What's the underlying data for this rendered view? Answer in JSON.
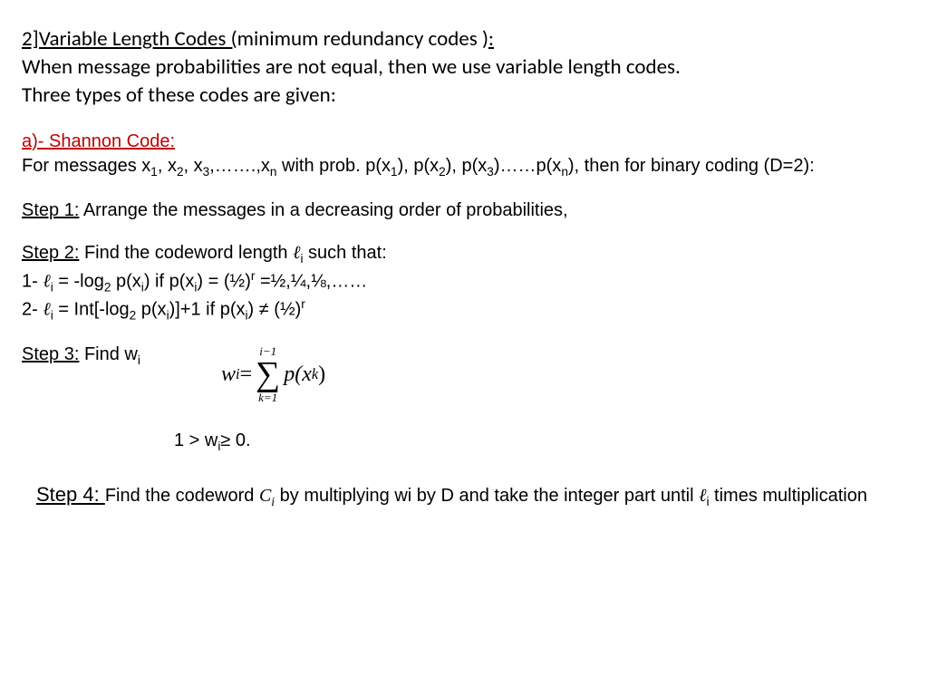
{
  "title": {
    "prefix": "2]Variable Length Codes (",
    "mid": "minimum redundancy codes )",
    "suffix": ":"
  },
  "intro": {
    "line1": "When message probabilities are not equal, then we use variable length codes.",
    "line2": "Three types of these codes are given:"
  },
  "sectionA": {
    "head": "a)- Shannon Code: ",
    "msg_pre": "For messages x",
    "s1": "1",
    "comma_x": ", x",
    "s2": "2",
    "s3": "3",
    "dots_x": ",…….,x",
    "sn": "n",
    "prob_pre": " with prob. p(x",
    "pc": "), p(x",
    "pdots": ")……p(x",
    "tail": "), then for binary coding (D=2):"
  },
  "step1": {
    "label": "Step 1:",
    "text": " Arrange the messages in a decreasing order of probabilities,"
  },
  "step2": {
    "label": "Step 2:",
    "text_a": " Find the codeword length  ",
    "ell": "ℓ",
    "isub": "i",
    "text_b": " such that:",
    "line1_a": " 1- ",
    "line1_b": " = -log",
    "two": "2",
    "line1_c": " p(x",
    "line1_d": ")  if   p(x",
    "line1_e": ") = (½)",
    "r": "r",
    "line1_f": " =½,¼,⅛,……",
    "line2_a": " 2- ",
    "line2_b": " = Int[-log",
    "line2_c": " p(x",
    "line2_d": ")]+1 if  p(x",
    "line2_e": ") ≠ (½)"
  },
  "step3": {
    "label": "Step 3:",
    "text": " Find w",
    "formula_w": "w",
    "eq": " = ",
    "top": "i−1",
    "sigma": "∑",
    "bot": "k=1",
    "px": "p(x",
    "k": "k",
    "close": " )",
    "wline_a": "1 > w",
    "wline_b": "≥ 0."
  },
  "step4": {
    "label": "Step 4: ",
    "a": "Find the codeword ",
    "C": "C",
    "Ci": "i",
    "b": " by multiplying wi by D and take the integer part until  ",
    "ell": "ℓ",
    "isub": "i",
    "c": "  times multiplication"
  }
}
